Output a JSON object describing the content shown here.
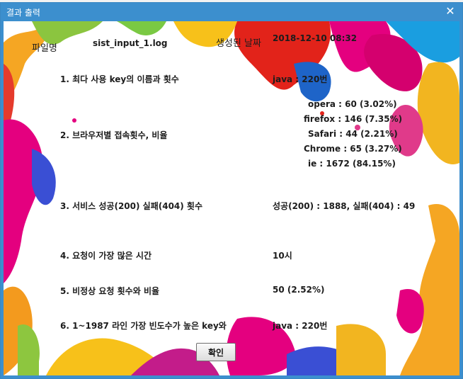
{
  "window": {
    "title": "결과 출력"
  },
  "header": {
    "filename_label": "파일명",
    "filename_value": "sist_input_1.log",
    "created_label": "생성된 날짜",
    "created_value": "2018-12-10 08:32"
  },
  "results": [
    {
      "label": "1. 최다 사용 key의 이름과 횟수",
      "value": "java : 220번"
    },
    {
      "label": "2. 브라우저별 접속횟수, 비율",
      "browsers": [
        "opera : 60 (3.02%)",
        "firefox : 146 (7.35%)",
        "Safari : 44 (2.21%)",
        "Chrome : 65 (3.27%)",
        "ie : 1672 (84.15%)"
      ]
    },
    {
      "label": "3. 서비스 성공(200) 실패(404) 횟수",
      "value": "성공(200) : 1888, 실패(404) : 49"
    },
    {
      "label": "4. 요청이 가장 많은 시간",
      "value": "10시"
    },
    {
      "label": "5. 비정상 요청 횟수와 비율",
      "value": "50 (2.52%)"
    },
    {
      "label": "6. 1~1987 라인 가장 빈도수가 높은 key와",
      "value": "java : 220번"
    }
  ],
  "buttons": {
    "ok": "확인"
  },
  "colors": {
    "titlebar": "#3c8fce",
    "text": "#1c1c1c"
  }
}
